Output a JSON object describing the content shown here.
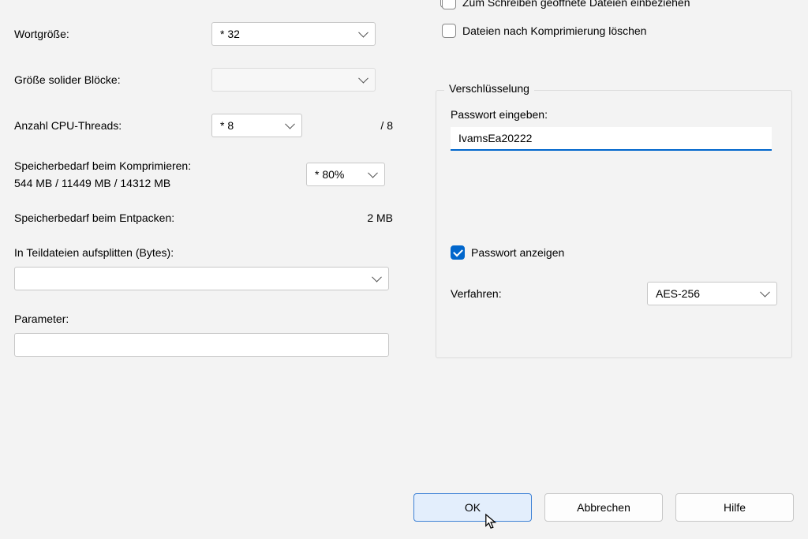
{
  "left": {
    "word_size": {
      "label": "Wortgröße:",
      "value": "* 32"
    },
    "solid_block_size": {
      "label": "Größe solider Blöcke:",
      "value": ""
    },
    "cpu_threads": {
      "label": "Anzahl CPU-Threads:",
      "value": "* 8",
      "suffix": "/ 8"
    },
    "mem_compress": {
      "label": "Speicherbedarf beim Komprimieren:",
      "detail": "544 MB / 11449 MB / 14312 MB",
      "value": "* 80%"
    },
    "mem_decompress": {
      "label": "Speicherbedarf beim Entpacken:",
      "value": "2 MB"
    },
    "split": {
      "label": "In Teildateien aufsplitten (Bytes):",
      "value": ""
    },
    "parameter": {
      "label": "Parameter:",
      "value": ""
    }
  },
  "right": {
    "top_checkbox_cut": "Zum Schreiben geöffnete Dateien einbeziehen",
    "delete_after": "Dateien nach Komprimierung löschen",
    "encryption": {
      "title": "Verschlüsselung",
      "pw_label": "Passwort eingeben:",
      "pw_value": "IvamsEa20222",
      "show_pw": "Passwort anzeigen",
      "method_label": "Verfahren:",
      "method_value": "AES-256"
    }
  },
  "buttons": {
    "ok": "OK",
    "cancel": "Abbrechen",
    "help": "Hilfe"
  }
}
